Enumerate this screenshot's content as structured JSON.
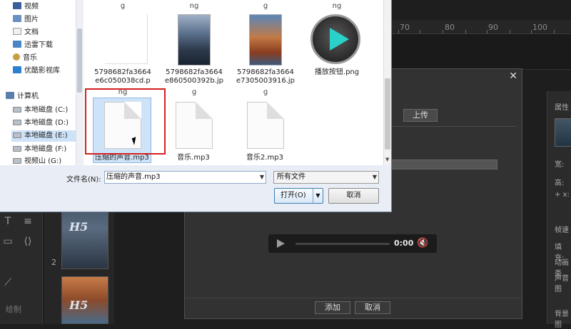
{
  "ruler": {
    "ticks": [
      "70",
      "80",
      "90",
      "100"
    ]
  },
  "nav": {
    "items": [
      {
        "label": "视频",
        "icon": "video-icon"
      },
      {
        "label": "图片",
        "icon": "picture-icon"
      },
      {
        "label": "文档",
        "icon": "document-icon"
      },
      {
        "label": "迅雷下载",
        "icon": "download-icon"
      },
      {
        "label": "音乐",
        "icon": "music-icon"
      },
      {
        "label": "优酷影视库",
        "icon": "youku-icon"
      }
    ],
    "computer": "计算机",
    "drives": [
      "本地磁盘 (C:)",
      "本地磁盘 (D:)",
      "本地磁盘 (E:)",
      "本地磁盘 (F:)",
      "视频山 (G:)"
    ],
    "selected_drive": "本地磁盘 (E:)"
  },
  "files": {
    "row1_tops": [
      "g",
      "ng",
      "g",
      "ng"
    ],
    "row1": [
      {
        "name": "5798682fa3664\ne6c050038cd.p",
        "icon": "blank-file-icon"
      },
      {
        "name": "5798682fa3664\ne860500392b.jp",
        "icon": "photo-thumbnail-icon"
      },
      {
        "name": "5798682fa3664\ne7305003916.jp",
        "icon": "photo-thumbnail-icon"
      },
      {
        "name": "播放按钮.png",
        "icon": "play-button-icon"
      }
    ],
    "row2_tops": [
      "ng",
      "g",
      "g"
    ],
    "row2": [
      {
        "name": "压缩的声音.mp3",
        "icon": "blank-file-icon",
        "selected": true
      },
      {
        "name": "音乐.mp3",
        "icon": "blank-file-icon"
      },
      {
        "name": "音乐2.mp3",
        "icon": "blank-file-icon"
      }
    ]
  },
  "footer": {
    "filename_label": "文件名(N):",
    "filename_value": "压缩的声音.mp3",
    "filetype_value": "所有文件",
    "open_label": "打开(O)",
    "cancel_label": "取消"
  },
  "mid_dialog": {
    "upload_label": "上传",
    "audio_time": "0:00",
    "add_label": "添加",
    "cancel_label": "取消"
  },
  "right_panel": {
    "labels": [
      "属性",
      "宽:",
      "高:",
      "+ x:",
      "帧速",
      "填充:",
      "动画类",
      "声音图",
      "背景图"
    ]
  },
  "left_panel": {
    "draw_label": "绘制",
    "page_number": "2"
  }
}
